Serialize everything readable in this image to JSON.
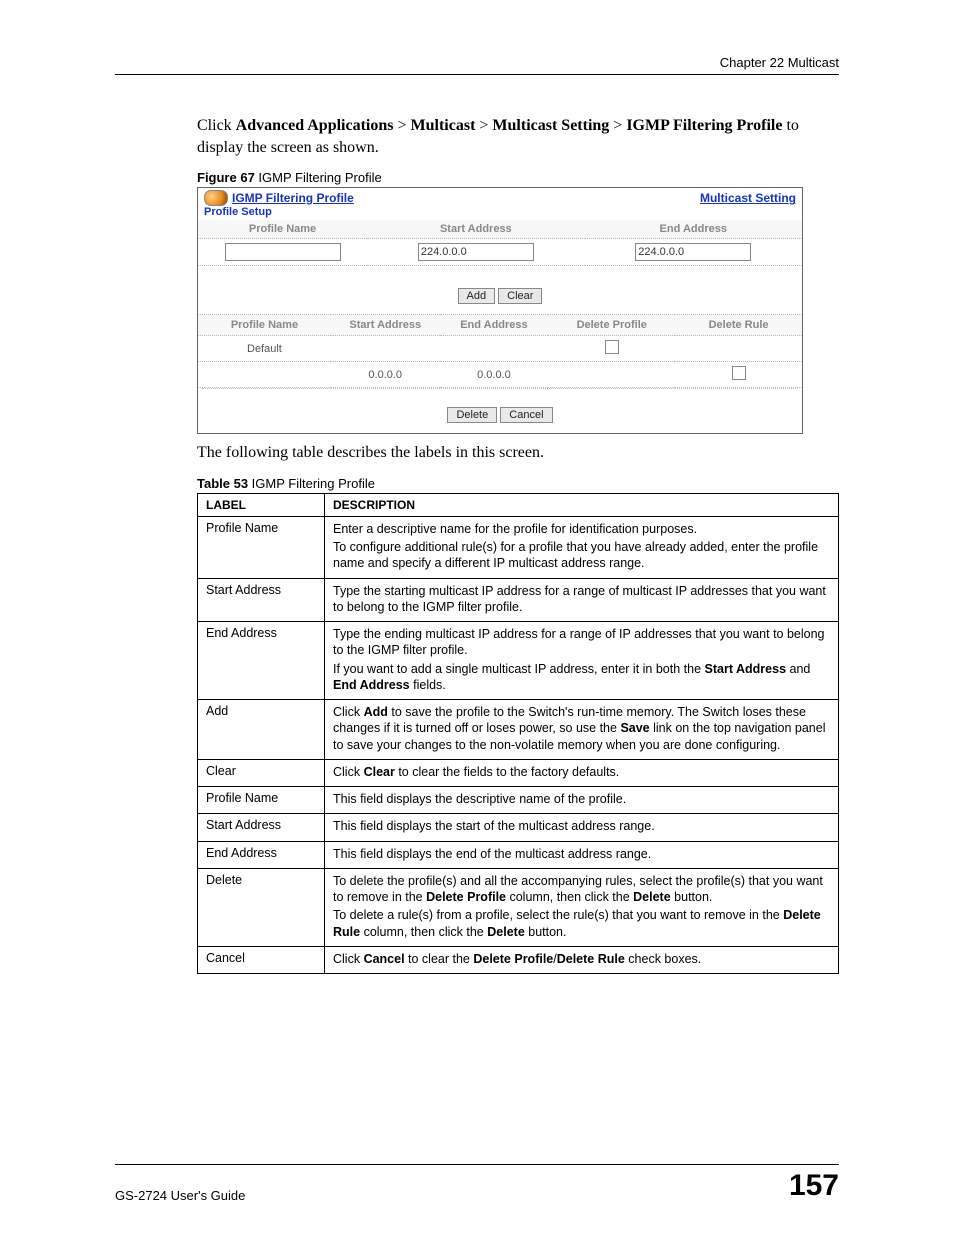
{
  "header": {
    "chapter": "Chapter 22 Multicast"
  },
  "intro": {
    "pre": "Click ",
    "b1": "Advanced Applications",
    "gt1": " > ",
    "b2": "Multicast",
    "gt2": " > ",
    "b3": "Multicast Setting",
    "gt3": " > ",
    "b4": "IGMP Filtering Profile",
    "post": " to display the screen as shown."
  },
  "fig": {
    "label": "Figure 67",
    "title": "   IGMP Filtering Profile"
  },
  "shot": {
    "title": "IGMP Filtering Profile",
    "link": "Multicast Setting",
    "setup": "Profile Setup",
    "h_profile": "Profile Name",
    "h_start": "Start Address",
    "h_end": "End Address",
    "v_start": "224.0.0.0",
    "v_end": "224.0.0.0",
    "btn_add": "Add",
    "btn_clear": "Clear",
    "g_profile": "Profile Name",
    "g_start": "Start Address",
    "g_end": "End Address",
    "g_delprof": "Delete Profile",
    "g_delrule": "Delete Rule",
    "row1_name": "Default",
    "row2_start": "0.0.0.0",
    "row2_end": "0.0.0.0",
    "btn_delete": "Delete",
    "btn_cancel": "Cancel"
  },
  "after_shot": "The following table describes the labels in this screen.",
  "tbl": {
    "label": "Table 53",
    "title": "   IGMP Filtering Profile",
    "h1": "LABEL",
    "h2": "DESCRIPTION"
  },
  "rows": [
    {
      "l": "Profile Name",
      "d1": "Enter a descriptive name for the profile for identification purposes.",
      "d2": "To configure additional rule(s) for a profile that you have already added, enter the profile name and specify a different IP multicast address range."
    },
    {
      "l": "Start Address",
      "d1": "Type the starting multicast IP address for a range of multicast IP addresses that you want to belong to the IGMP filter profile."
    },
    {
      "l": "End Address",
      "d1": "Type the ending multicast IP address for a range of IP addresses that you want to belong to the IGMP filter profile.",
      "d2_pre": "If you want to add a single multicast IP address, enter it in both the ",
      "d2_b1": "Start Address",
      "d2_mid": " and ",
      "d2_b2": "End Address",
      "d2_post": " fields."
    },
    {
      "l": "Add",
      "d1_pre": "Click ",
      "d1_b1": "Add",
      "d1_mid": " to save the profile to the Switch's run-time memory. The Switch loses these changes if it is turned off or loses power, so use the ",
      "d1_b2": "Save",
      "d1_post": " link on the top navigation panel to save your changes to the non-volatile memory when you are done configuring."
    },
    {
      "l": "Clear",
      "d1_pre": "Click ",
      "d1_b1": "Clear",
      "d1_post": " to clear the fields to the factory defaults."
    },
    {
      "l": "Profile Name",
      "d1": "This field displays the descriptive name of the profile."
    },
    {
      "l": "Start Address",
      "d1": "This field displays the start of the multicast address range."
    },
    {
      "l": "End Address",
      "d1": "This field displays the end of the multicast address range."
    },
    {
      "l": "Delete",
      "d1_pre": "To delete the profile(s) and all the accompanying rules, select the profile(s) that you want to remove in the ",
      "d1_b1": "Delete Profile",
      "d1_mid": " column, then click the ",
      "d1_b2": "Delete",
      "d1_post": " button.",
      "d2_pre": "To delete a rule(s) from a profile, select the rule(s) that you want to remove in the ",
      "d2_b1": "Delete Rule",
      "d2_mid": " column, then click the ",
      "d2_b2": "Delete",
      "d2_post": " button."
    },
    {
      "l": "Cancel",
      "d1_pre": "Click ",
      "d1_b1": "Cancel",
      "d1_mid": " to clear the ",
      "d1_b2": "Delete Profile",
      "d1_mid2": "/",
      "d1_b3": "Delete Rule",
      "d1_post": " check boxes."
    }
  ],
  "footer": {
    "guide": "GS-2724 User's Guide",
    "page": "157"
  }
}
